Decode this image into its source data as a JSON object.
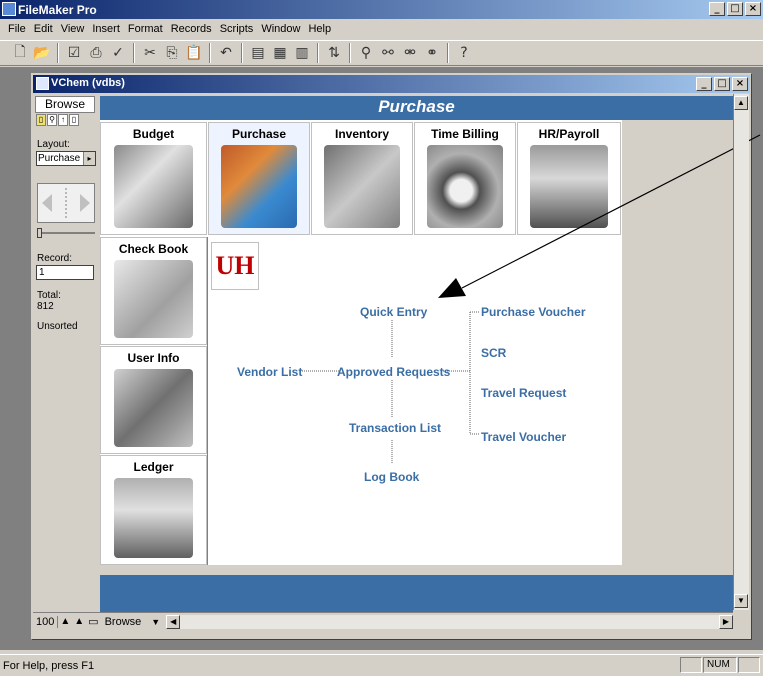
{
  "app": {
    "title": "FileMaker Pro"
  },
  "menu": [
    "File",
    "Edit",
    "View",
    "Insert",
    "Format",
    "Records",
    "Scripts",
    "Window",
    "Help"
  ],
  "document": {
    "title": "VChem (vdbs)"
  },
  "status_area": {
    "mode": "Browse",
    "layout_label": "Layout:",
    "layout_value": "Purchase",
    "record_label": "Record:",
    "record_value": "1",
    "total_label": "Total:",
    "total_value": "812",
    "sort_state": "Unsorted"
  },
  "header": {
    "title": "Purchase"
  },
  "nav_tiles": [
    {
      "label": "Budget"
    },
    {
      "label": "Purchase"
    },
    {
      "label": "Inventory"
    },
    {
      "label": "Time Billing"
    },
    {
      "label": "HR/Payroll"
    },
    {
      "label": "Check Book"
    },
    {
      "label": "User Info"
    },
    {
      "label": "Ledger"
    }
  ],
  "logo_text": "UH",
  "links": {
    "quick_entry": "Quick Entry",
    "purchase_voucher": "Purchase Voucher",
    "scr": "SCR",
    "vendor_list": "Vendor List",
    "approved_requests": "Approved Requests",
    "travel_request": "Travel Request",
    "transaction_list": "Transaction List",
    "travel_voucher": "Travel Voucher",
    "log_book": "Log Book"
  },
  "bottom_bar": {
    "zoom": "100",
    "mode": "Browse"
  },
  "status_bar": {
    "help_text": "For Help, press F1",
    "num": "NUM"
  },
  "colors": {
    "accent": "#3a6ea5",
    "title_bar": "#0a246a",
    "logo_red": "#c00000"
  }
}
